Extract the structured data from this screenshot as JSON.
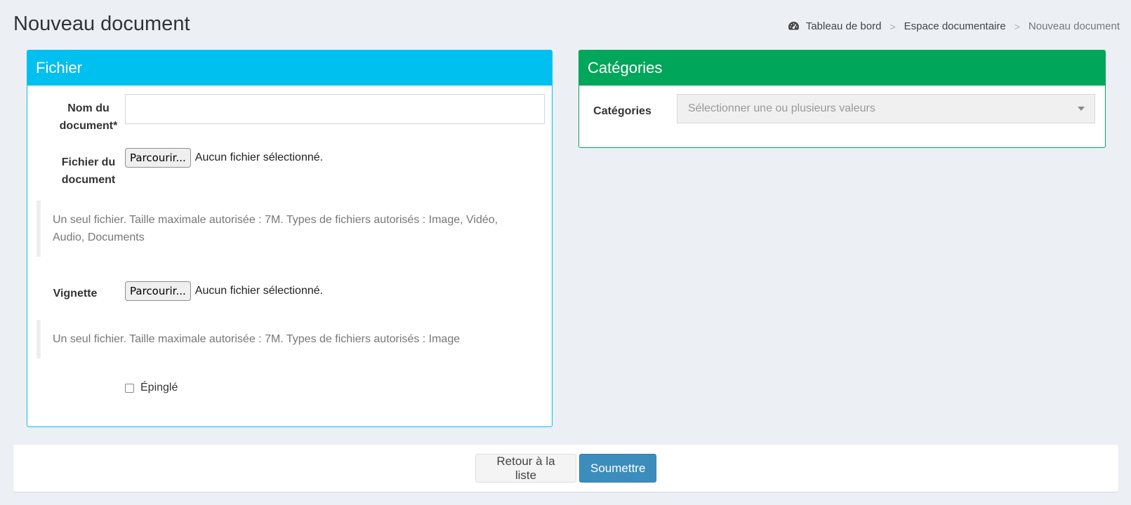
{
  "page": {
    "title": "Nouveau document"
  },
  "breadcrumb": {
    "items": [
      {
        "label": "Tableau de bord",
        "icon": "dashboard-icon"
      },
      {
        "label": "Espace documentaire"
      },
      {
        "label": "Nouveau document"
      }
    ],
    "separator": ">"
  },
  "file_box": {
    "title": "Fichier",
    "color": "#00c0ef",
    "name_label": "Nom du document*",
    "name_value": "",
    "file_label": "Fichier du document",
    "file_button": "Parcourir...",
    "file_status": "Aucun fichier sélectionné.",
    "file_help": "Un seul fichier. Taille maximale autorisée : 7M. Types de fichiers autorisés : Image, Vidéo, Audio, Documents",
    "thumb_label": "Vignette",
    "thumb_button": "Parcourir...",
    "thumb_status": "Aucun fichier sélectionné.",
    "thumb_help": "Un seul fichier. Taille maximale autorisée : 7M. Types de fichiers autorisés : Image",
    "pinned_label": "Épinglé",
    "pinned_checked": false
  },
  "category_box": {
    "title": "Catégories",
    "color": "#00a65a",
    "label": "Catégories",
    "placeholder": "Sélectionner une ou plusieurs valeurs"
  },
  "footer": {
    "back_label": "Retour à la liste",
    "submit_label": "Soumettre",
    "submit_color": "#3c8dbc"
  }
}
